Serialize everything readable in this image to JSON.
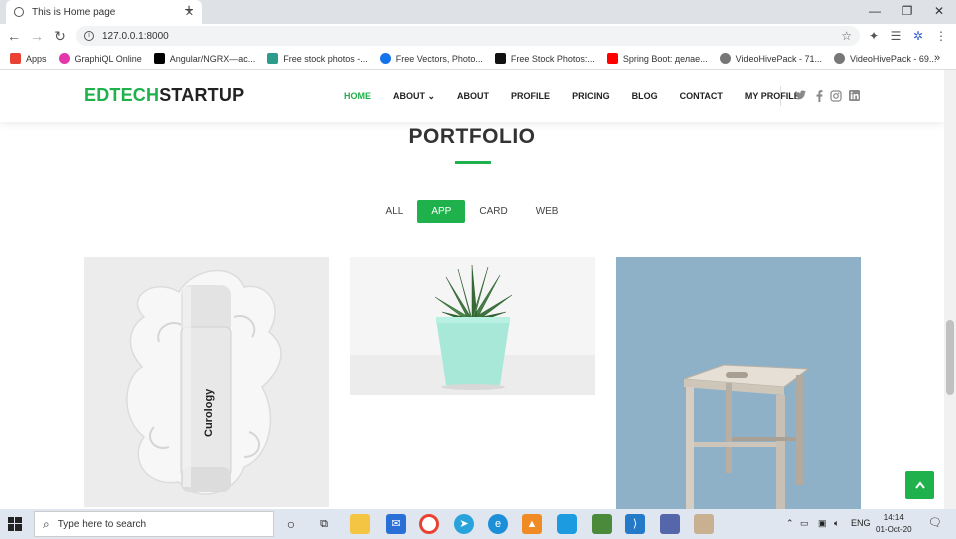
{
  "browser": {
    "tab_title": "This is Home page",
    "url": "127.0.0.1:8000",
    "bookmarks": [
      {
        "label": "Apps",
        "color": "#e94235"
      },
      {
        "label": "GraphiQL Online",
        "color": "#e535ab"
      },
      {
        "label": "Angular/NGRX—ac...",
        "color": "#000000"
      },
      {
        "label": "Free stock photos -...",
        "color": "#2d9c8a"
      },
      {
        "label": "Free Vectors, Photo...",
        "color": "#1273eb"
      },
      {
        "label": "Free Stock Photos:...",
        "color": "#111111"
      },
      {
        "label": "Spring Boot: делае...",
        "color": "#ff0000"
      },
      {
        "label": "VideoHivePack - 71...",
        "color": "#555555"
      },
      {
        "label": "VideoHivePack - 69...",
        "color": "#555555"
      }
    ]
  },
  "site": {
    "logo_green": "EDTECH",
    "logo_dark": "STARTUP",
    "accent": "#1fb14c",
    "nav": [
      {
        "label": "HOME",
        "active": true
      },
      {
        "label": "ABOUT ⌄",
        "active": false
      },
      {
        "label": "ABOUT",
        "active": false
      },
      {
        "label": "PROFILE",
        "active": false
      },
      {
        "label": "PRICING",
        "active": false
      },
      {
        "label": "BLOG",
        "active": false
      },
      {
        "label": "CONTACT",
        "active": false
      },
      {
        "label": "MY PROFILE",
        "active": false
      }
    ],
    "social_icons": [
      "twitter-icon",
      "facebook-icon",
      "instagram-icon",
      "linkedin-icon"
    ],
    "section_title": "PORTFOLIO",
    "filters": [
      {
        "label": "ALL",
        "active": false
      },
      {
        "label": "APP",
        "active": true
      },
      {
        "label": "CARD",
        "active": false
      },
      {
        "label": "WEB",
        "active": false
      }
    ],
    "cards": [
      {
        "product_text": "Curology",
        "image": "cream-bottle"
      },
      {
        "image": "succulent-pot"
      },
      {
        "image": "wooden-stool"
      }
    ]
  },
  "taskbar": {
    "search_placeholder": "Type here to search",
    "language": "ENG",
    "time": "14:14",
    "date": "01-Oct-20"
  }
}
